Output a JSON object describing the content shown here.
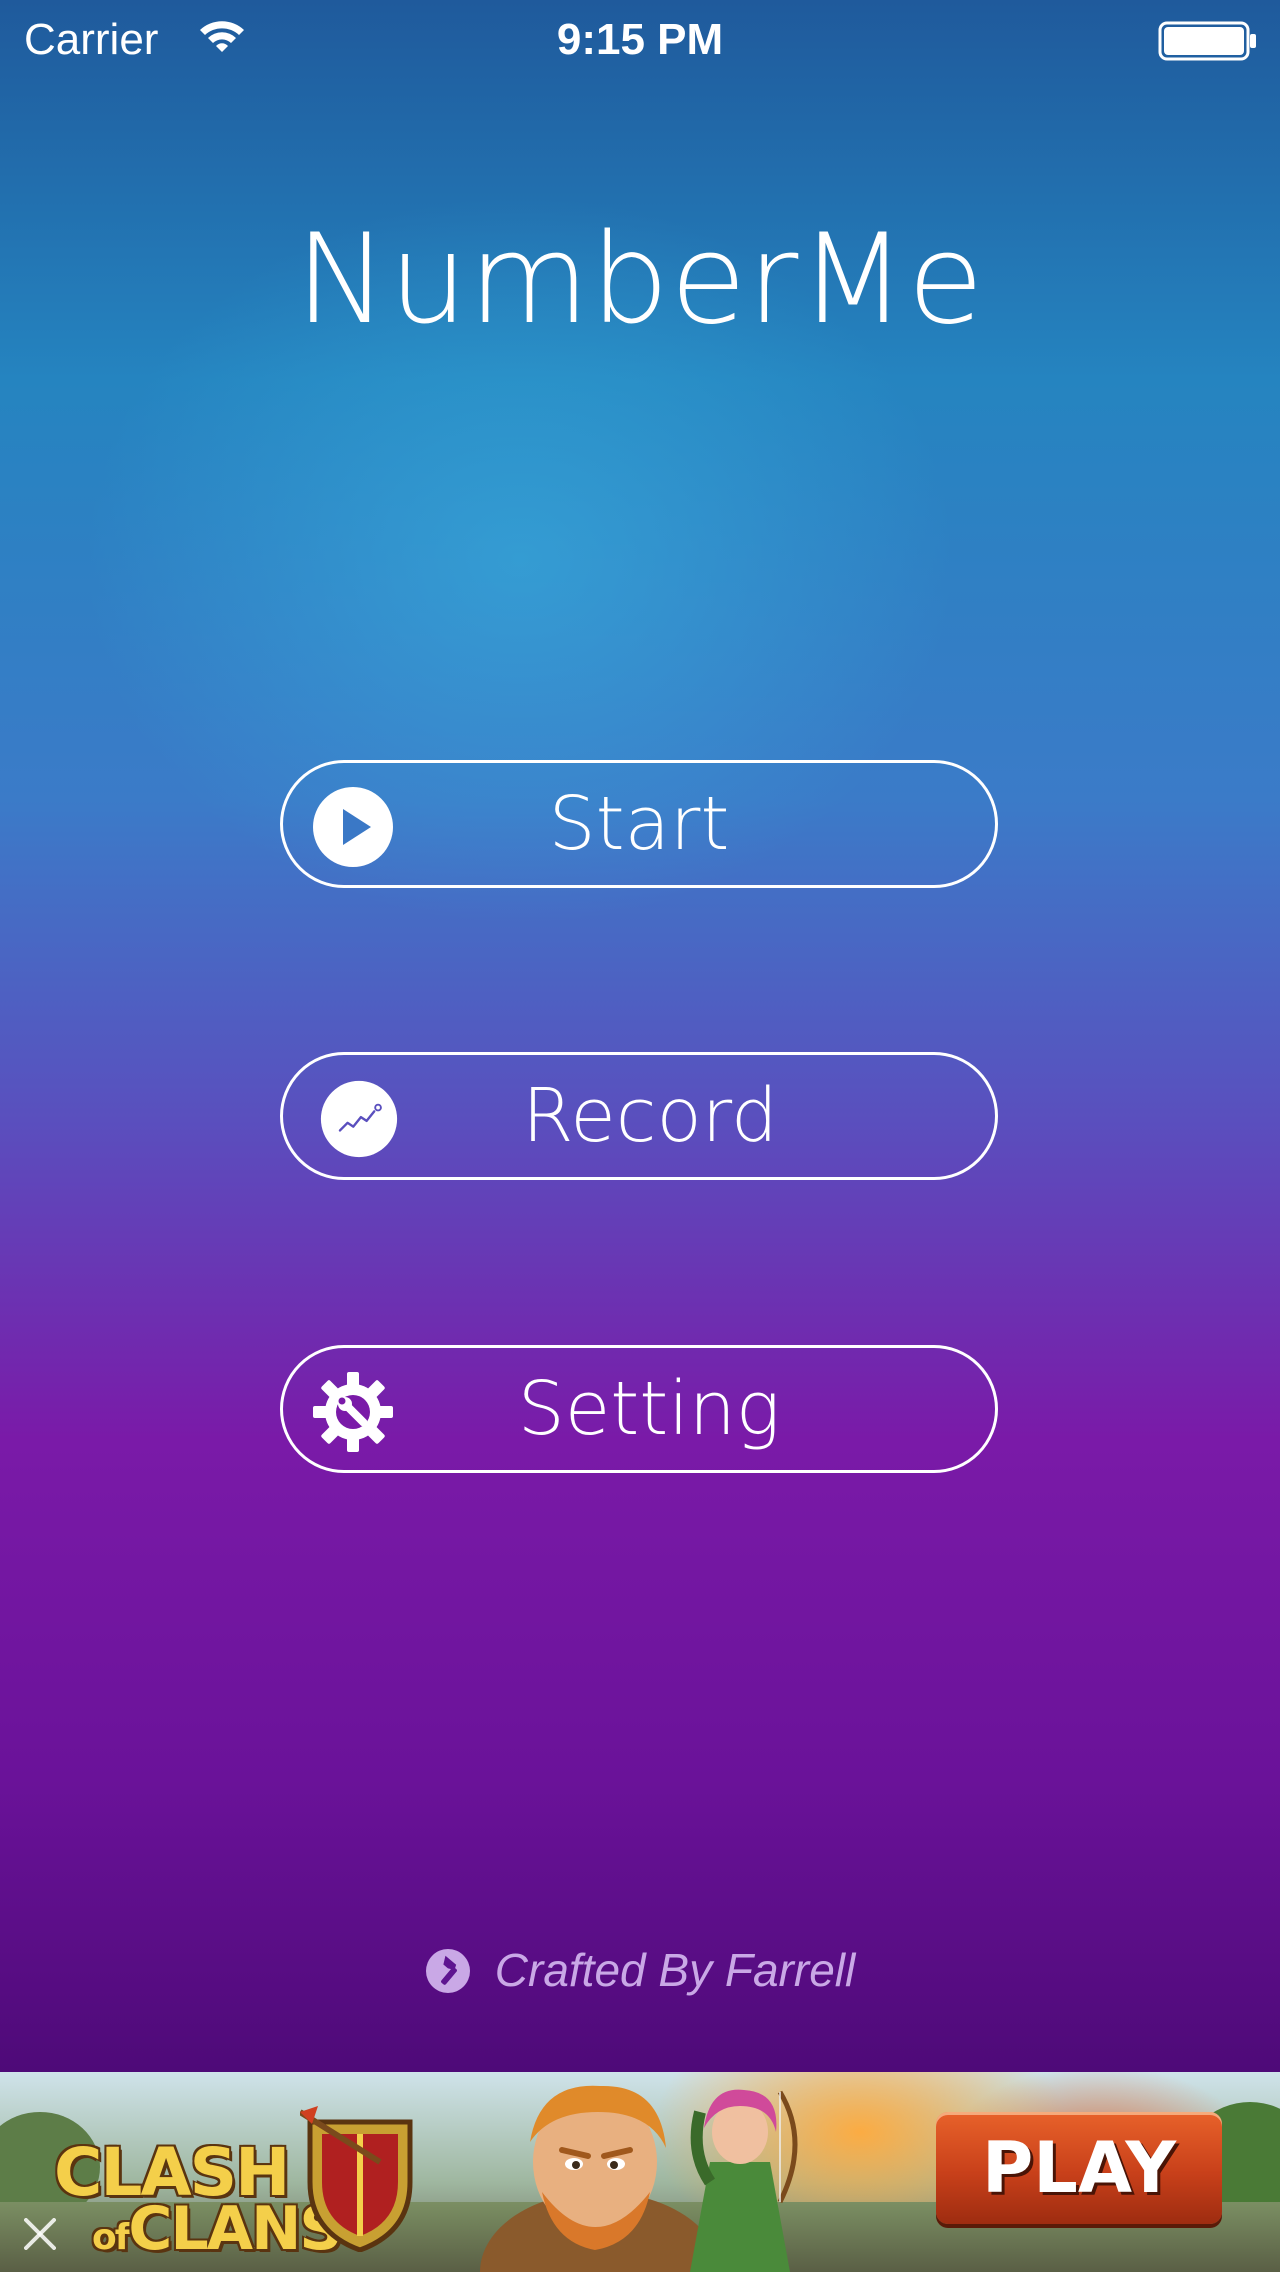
{
  "status_bar": {
    "carrier": "Carrier",
    "time": "9:15 PM",
    "wifi_icon": "wifi-icon",
    "battery_icon": "battery-full-icon"
  },
  "app": {
    "title": "NumberMe"
  },
  "menu": {
    "start": {
      "label": "Start",
      "icon": "play-circle-icon"
    },
    "record": {
      "label": "Record",
      "icon": "chart-line-circle-icon"
    },
    "setting": {
      "label": "Setting",
      "icon": "gear-wrench-icon"
    }
  },
  "footer": {
    "credit": "Crafted By Farrell",
    "icon": "hammer-circle-icon"
  },
  "ad": {
    "logo_line1": "CLASH",
    "logo_of": "of",
    "logo_line2": "CLANS",
    "cta_label": "PLAY",
    "close_icon": "close-icon"
  },
  "colors": {
    "top": "#1f5a9c",
    "mid": "#3b7bc8",
    "purple": "#7a1aa8",
    "bottom": "#4e0a78",
    "text": "#ffffff",
    "credit_text": "#c9a8e6",
    "play_button": "#c8401a"
  }
}
